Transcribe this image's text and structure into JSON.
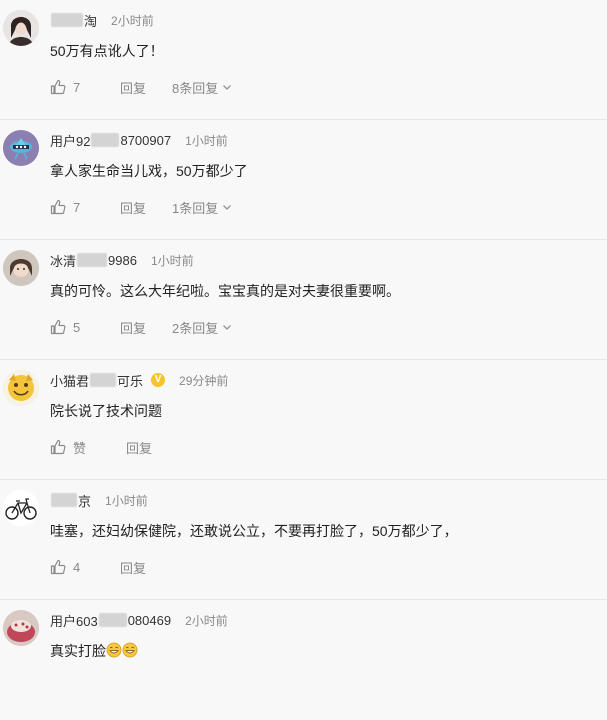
{
  "comments": [
    {
      "username_tail": "淘",
      "time": "2小时前",
      "content": "50万有点讹人了！",
      "likes": "7",
      "reply_label": "回复",
      "replies_label": "8条回复"
    },
    {
      "username_head": "用户92",
      "username_tail": "8700907",
      "time": "1小时前",
      "content": "拿人家生命当儿戏，50万都少了",
      "likes": "7",
      "reply_label": "回复",
      "replies_label": "1条回复"
    },
    {
      "username_head": "冰清",
      "username_tail": "9986",
      "time": "1小时前",
      "content": "真的可怜。这么大年纪啦。宝宝真的是对夫妻很重要啊。",
      "likes": "5",
      "reply_label": "回复",
      "replies_label": "2条回复"
    },
    {
      "username_head": "小猫君",
      "username_tail": "可乐",
      "badge": "V",
      "time": "29分钟前",
      "content": "院长说了技术问题",
      "likes": "赞",
      "reply_label": "回复"
    },
    {
      "username_tail": "京",
      "time": "1小时前",
      "content": "哇塞，还妇幼保健院，还敢说公立，不要再打脸了，50万都少了，",
      "likes": "4",
      "reply_label": "回复"
    },
    {
      "username_head": "用户603",
      "username_tail": "080469",
      "time": "2小时前",
      "content": "真实打脸"
    }
  ],
  "colors": {
    "background": "#f8f8f8",
    "text": "#222222",
    "meta": "#888888",
    "badge": "#f6c42e"
  },
  "icons": [
    "thumb-up-icon",
    "chevron-down-icon",
    "grin-emoji-icon",
    "vip-badge-icon"
  ]
}
